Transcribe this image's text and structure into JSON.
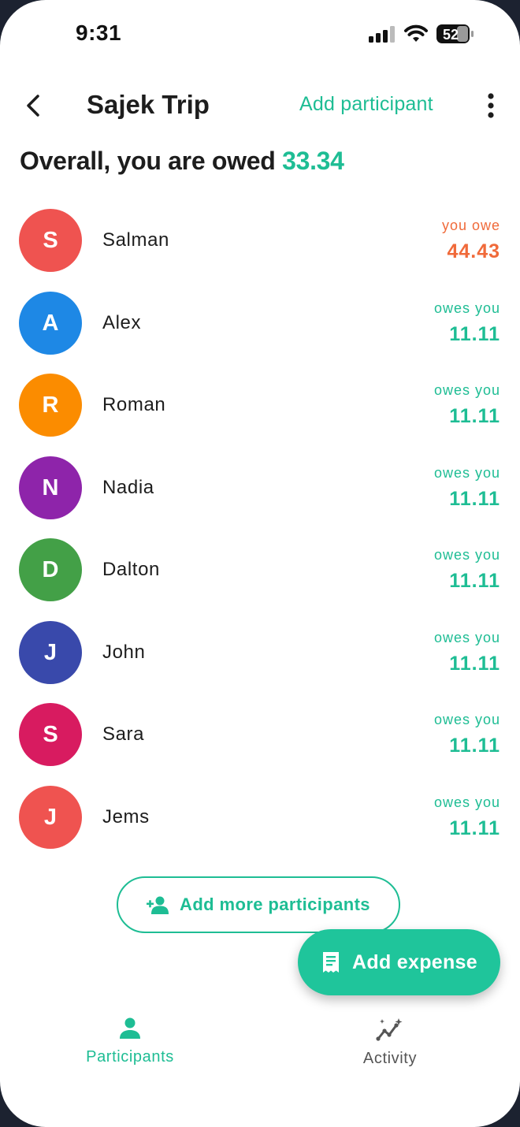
{
  "status_bar": {
    "time": "9:31",
    "battery": "52"
  },
  "header": {
    "title": "Sajek Trip",
    "add_participant_label": "Add participant"
  },
  "summary": {
    "prefix": "Overall, you are owed ",
    "amount": "33.34"
  },
  "colors": {
    "accent": "#1ebd94",
    "owe": "#f06a3a"
  },
  "participants": [
    {
      "initial": "S",
      "name": "Salman",
      "status": "you owe",
      "amount": "44.43",
      "color": "#ef5350",
      "status_color": "#f06a3a"
    },
    {
      "initial": "A",
      "name": "Alex",
      "status": "owes you",
      "amount": "11.11",
      "color": "#1e88e5",
      "status_color": "#1ebd94"
    },
    {
      "initial": "R",
      "name": "Roman",
      "status": "owes you",
      "amount": "11.11",
      "color": "#fb8c00",
      "status_color": "#1ebd94"
    },
    {
      "initial": "N",
      "name": "Nadia",
      "status": "owes you",
      "amount": "11.11",
      "color": "#8e24aa",
      "status_color": "#1ebd94"
    },
    {
      "initial": "D",
      "name": "Dalton",
      "status": "owes you",
      "amount": "11.11",
      "color": "#43a047",
      "status_color": "#1ebd94"
    },
    {
      "initial": "J",
      "name": "John",
      "status": "owes you",
      "amount": "11.11",
      "color": "#3949ab",
      "status_color": "#1ebd94"
    },
    {
      "initial": "S",
      "name": "Sara",
      "status": "owes you",
      "amount": "11.11",
      "color": "#d81b60",
      "status_color": "#1ebd94"
    },
    {
      "initial": "J",
      "name": "Jems",
      "status": "owes you",
      "amount": "11.11",
      "color": "#ef5350",
      "status_color": "#1ebd94"
    }
  ],
  "add_more_label": "Add more participants",
  "fab_label": "Add expense",
  "bottom_nav": [
    {
      "label": "Participants",
      "icon": "person-icon",
      "active": true
    },
    {
      "label": "Activity",
      "icon": "activity-icon",
      "active": false
    }
  ]
}
